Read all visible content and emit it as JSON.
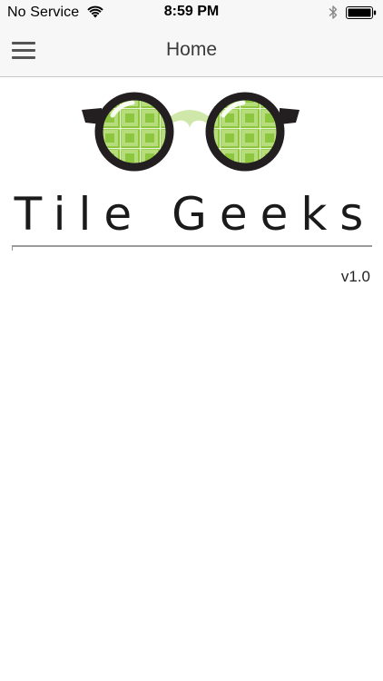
{
  "status_bar": {
    "carrier": "No Service",
    "time": "8:59 PM",
    "icons": [
      "wifi-icon",
      "bluetooth-icon",
      "battery-icon"
    ]
  },
  "nav_bar": {
    "title": "Home",
    "menu_icon": "hamburger-menu-icon"
  },
  "content": {
    "brand": "Tile Geeks",
    "version": "v1.0"
  },
  "colors": {
    "nav_background": "#f7f7f7",
    "glasses_frame": "#231f20",
    "lens_green": "#8dc63f",
    "lens_light_green": "#c5e39a",
    "bridge_green": "#cfe7a8"
  }
}
